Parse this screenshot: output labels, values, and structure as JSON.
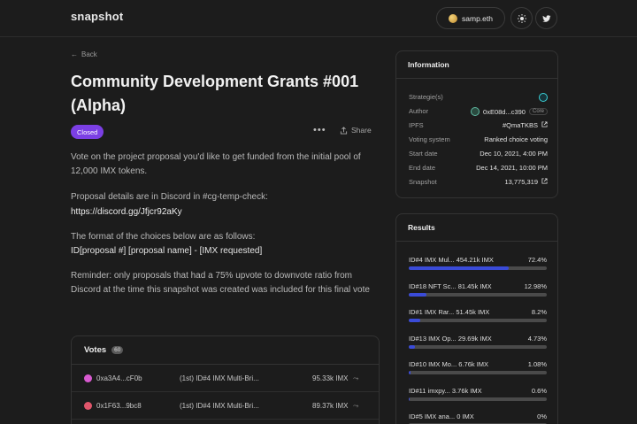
{
  "header": {
    "logo": "snapshot",
    "account": "samp.eth",
    "theme_icon": "sun-icon",
    "social_icon": "twitter-icon"
  },
  "proposal": {
    "back_label": "Back",
    "title": "Community Development Grants #001 (Alpha)",
    "status": "Closed",
    "share_label": "Share",
    "paragraphs": [
      "Vote on the project proposal you'd like to get funded from the initial pool of 12,000 IMX tokens.",
      "Proposal details are in Discord in #cg-temp-check:",
      "https://discord.gg/Jfjcr92aKy",
      "The format of the choices below are as follows:",
      "ID[proposal #] [proposal name] - [IMX requested]",
      "Reminder: only proposals that had a 75% upvote to downvote ratio from Discord at the time this snapshot was created was included for this final vote"
    ]
  },
  "votes": {
    "title": "Votes",
    "count": "60",
    "rows": [
      {
        "address": "0xa3A4...cF0b",
        "choice": "(1st) ID#4 IMX Multi-Bri...",
        "power": "95.33k IMX",
        "avatar_color": "#d85ad0"
      },
      {
        "address": "0x1F63...9bc8",
        "choice": "(1st) ID#4 IMX Multi-Bri...",
        "power": "89.37k IMX",
        "avatar_color": "#e0566b"
      }
    ]
  },
  "info": {
    "title": "Information",
    "rows": [
      {
        "label": "Strategie(s)",
        "value": ""
      },
      {
        "label": "Author",
        "value": "0xE08d...c390",
        "tag": "Core"
      },
      {
        "label": "IPFS",
        "value": "#QmaTKBS"
      },
      {
        "label": "Voting system",
        "value": "Ranked choice voting"
      },
      {
        "label": "Start date",
        "value": "Dec 10, 2021, 4:00 PM"
      },
      {
        "label": "End date",
        "value": "Dec 14, 2021, 10:00 PM"
      },
      {
        "label": "Snapshot",
        "value": "13,775,319"
      }
    ]
  },
  "results": {
    "title": "Results",
    "accent": "#3a4bd8",
    "items": [
      {
        "label": "ID#4 IMX Mul... 454.21k IMX",
        "pct": "72.4%",
        "value": 72.4
      },
      {
        "label": "ID#18 NFT Sc... 81.45k IMX",
        "pct": "12.98%",
        "value": 12.98
      },
      {
        "label": "ID#1 IMX Rar... 51.45k IMX",
        "pct": "8.2%",
        "value": 8.2
      },
      {
        "label": "ID#13 IMX Op... 29.69k IMX",
        "pct": "4.73%",
        "value": 4.73
      },
      {
        "label": "ID#10 IMX Mo... 6.76k IMX",
        "pct": "1.08%",
        "value": 1.08
      },
      {
        "label": "ID#11 imxpy... 3.76k IMX",
        "pct": "0.6%",
        "value": 0.6
      },
      {
        "label": "ID#5 IMX ana... 0 IMX",
        "pct": "0%",
        "value": 0
      }
    ]
  }
}
